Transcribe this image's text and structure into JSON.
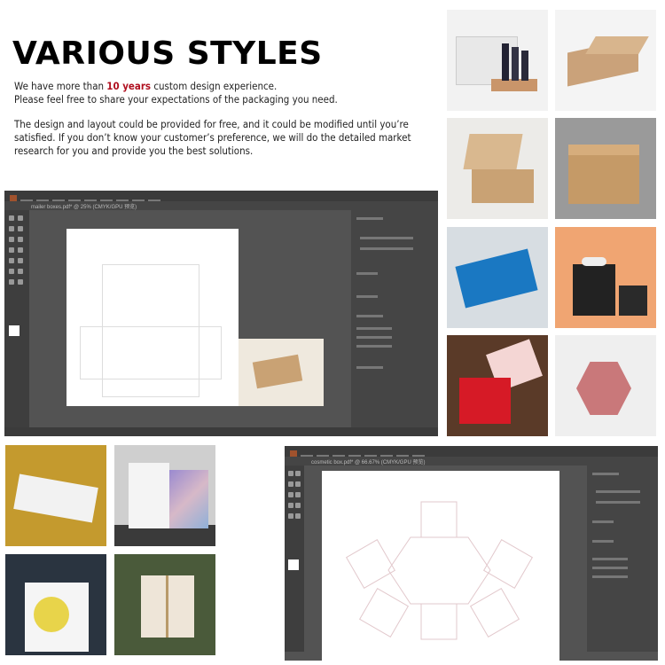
{
  "heading": "VARIOUS STYLES",
  "intro": {
    "line1_before": "We have more than ",
    "line1_highlight": "10 years",
    "line1_after": " custom design experience.",
    "line2": "Please feel free to share your expectations of the packaging you need.",
    "para2": "The design and layout could be provided for free, and it could be modified until you’re satisfied. If you don’t know your customer’s preference, we will do the detailed market research for you and provide you the best solutions."
  },
  "colors": {
    "highlight": "#b01020",
    "editor_bg": "#535353"
  },
  "gallery_right": [
    "white-box-with-cosmetic-bottles",
    "kraft-folding-box",
    "open-mailer-box-kraft",
    "kraft-shipping-box",
    "blue-printed-box",
    "black-gift-boxes-with-white-ribbon",
    "red-gift-box-with-ribbon",
    "hexagonal-pink-gift-box"
  ],
  "gallery_left": [
    "white-drawer-box-on-gold",
    "folding-presentation-box",
    "paper-bag-with-yellow-circle",
    "white-box-with-twine-christmas"
  ],
  "editor1": {
    "tab": "mailer boxes.pdf* @ 25% (CMYK/GPU 预览)"
  },
  "editor2": {
    "tab": "cosmetic box.pdf* @ 66.67% (CMYK/GPU 预览)"
  }
}
